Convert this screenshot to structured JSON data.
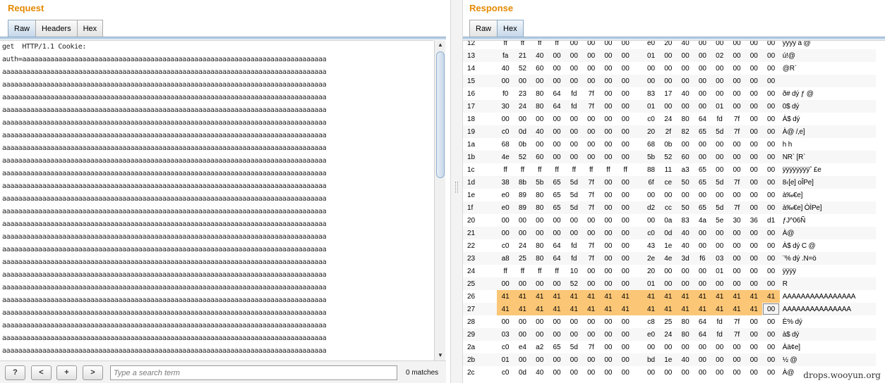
{
  "request": {
    "title": "Request",
    "tabs": [
      {
        "label": "Raw",
        "active": true
      },
      {
        "label": "Headers",
        "active": false
      },
      {
        "label": "Hex",
        "active": false
      }
    ],
    "raw_line_1": "get  HTTP/1.1 Cookie:",
    "raw_line_2": "auth=aaaaaaaaaaaaaaaaaaaaaaaaaaaaaaaaaaaaaaaaaaaaaaaaaaaaaaaaaaaaaaaaaaaaaaaaaaaa",
    "raw_fill_char": "a",
    "search": {
      "help_label": "?",
      "prev_label": "<",
      "add_label": "+",
      "next_label": ">",
      "placeholder": "Type a search term",
      "value": "",
      "matches": "0 matches"
    }
  },
  "response": {
    "title": "Response",
    "tabs": [
      {
        "label": "Raw",
        "active": false
      },
      {
        "label": "Hex",
        "active": true
      }
    ],
    "hex_rows": [
      {
        "off": "12",
        "bytes": [
          "ff",
          "ff",
          "ff",
          "ff",
          "00",
          "00",
          "00",
          "00",
          "e0",
          "20",
          "40",
          "00",
          "00",
          "00",
          "00",
          "00"
        ],
        "ascii": "ÿÿÿÿ        à @"
      },
      {
        "off": "13",
        "bytes": [
          "fa",
          "21",
          "40",
          "00",
          "00",
          "00",
          "00",
          "00",
          "01",
          "00",
          "00",
          "00",
          "02",
          "00",
          "00",
          "00"
        ],
        "ascii": "ú!@"
      },
      {
        "off": "14",
        "bytes": [
          "40",
          "52",
          "60",
          "00",
          "00",
          "00",
          "00",
          "00",
          "00",
          "00",
          "00",
          "00",
          "00",
          "00",
          "00",
          "00"
        ],
        "ascii": "@R`"
      },
      {
        "off": "15",
        "bytes": [
          "00",
          "00",
          "00",
          "00",
          "00",
          "00",
          "00",
          "00",
          "00",
          "00",
          "00",
          "00",
          "00",
          "00",
          "00",
          "00"
        ],
        "ascii": ""
      },
      {
        "off": "16",
        "bytes": [
          "f0",
          "23",
          "80",
          "64",
          "fd",
          "7f",
          "00",
          "00",
          "83",
          "17",
          "40",
          "00",
          "00",
          "00",
          "00",
          "00"
        ],
        "ascii": "ð# dý      ƒ @"
      },
      {
        "off": "17",
        "bytes": [
          "30",
          "24",
          "80",
          "64",
          "fd",
          "7f",
          "00",
          "00",
          "01",
          "00",
          "00",
          "00",
          "01",
          "00",
          "00",
          "00"
        ],
        "ascii": "0$ dý"
      },
      {
        "off": "18",
        "bytes": [
          "00",
          "00",
          "00",
          "00",
          "00",
          "00",
          "00",
          "00",
          "c0",
          "24",
          "80",
          "64",
          "fd",
          "7f",
          "00",
          "00"
        ],
        "ascii": "            À$ dý"
      },
      {
        "off": "19",
        "bytes": [
          "c0",
          "0d",
          "40",
          "00",
          "00",
          "00",
          "00",
          "00",
          "20",
          "2f",
          "82",
          "65",
          "5d",
          "7f",
          "00",
          "00"
        ],
        "ascii": "À@          /‚e]"
      },
      {
        "off": "1a",
        "bytes": [
          "68",
          "0b",
          "00",
          "00",
          "00",
          "00",
          "00",
          "00",
          "68",
          "0b",
          "00",
          "00",
          "00",
          "00",
          "00",
          "00"
        ],
        "ascii": "h           h"
      },
      {
        "off": "1b",
        "bytes": [
          "4e",
          "52",
          "60",
          "00",
          "00",
          "00",
          "00",
          "00",
          "5b",
          "52",
          "60",
          "00",
          "00",
          "00",
          "00",
          "00"
        ],
        "ascii": "NR`         [R`"
      },
      {
        "off": "1c",
        "bytes": [
          "ff",
          "ff",
          "ff",
          "ff",
          "ff",
          "ff",
          "ff",
          "ff",
          "88",
          "11",
          "a3",
          "65",
          "00",
          "00",
          "00",
          "00"
        ],
        "ascii": "ÿÿÿÿÿÿÿÿˆ £e"
      },
      {
        "off": "1d",
        "bytes": [
          "38",
          "8b",
          "5b",
          "65",
          "5d",
          "7f",
          "00",
          "00",
          "6f",
          "ce",
          "50",
          "65",
          "5d",
          "7f",
          "00",
          "00"
        ],
        "ascii": "8‹[e]      oÎPe]"
      },
      {
        "off": "1e",
        "bytes": [
          "e0",
          "89",
          "80",
          "65",
          "5d",
          "7f",
          "00",
          "00",
          "00",
          "00",
          "00",
          "00",
          "00",
          "00",
          "00",
          "00"
        ],
        "ascii": "à‰€e]"
      },
      {
        "off": "1f",
        "bytes": [
          "e0",
          "89",
          "80",
          "65",
          "5d",
          "7f",
          "00",
          "00",
          "d2",
          "cc",
          "50",
          "65",
          "5d",
          "7f",
          "00",
          "00"
        ],
        "ascii": "à‰€e]      ÒÌPe]"
      },
      {
        "off": "20",
        "bytes": [
          "00",
          "00",
          "00",
          "00",
          "00",
          "00",
          "00",
          "00",
          "00",
          "0a",
          "83",
          "4a",
          "5e",
          "30",
          "36",
          "d1"
        ],
        "ascii": "             ƒJ^06Ñ"
      },
      {
        "off": "21",
        "bytes": [
          "00",
          "00",
          "00",
          "00",
          "00",
          "00",
          "00",
          "00",
          "c0",
          "0d",
          "40",
          "00",
          "00",
          "00",
          "00",
          "00"
        ],
        "ascii": "            À@"
      },
      {
        "off": "22",
        "bytes": [
          "c0",
          "24",
          "80",
          "64",
          "fd",
          "7f",
          "00",
          "00",
          "43",
          "1e",
          "40",
          "00",
          "00",
          "00",
          "00",
          "00"
        ],
        "ascii": "À$ dý      C @"
      },
      {
        "off": "23",
        "bytes": [
          "a8",
          "25",
          "80",
          "64",
          "fd",
          "7f",
          "00",
          "00",
          "2e",
          "4e",
          "3d",
          "f6",
          "03",
          "00",
          "00",
          "00"
        ],
        "ascii": "¨% dý      .N=ö"
      },
      {
        "off": "24",
        "bytes": [
          "ff",
          "ff",
          "ff",
          "ff",
          "10",
          "00",
          "00",
          "00",
          "20",
          "00",
          "00",
          "00",
          "01",
          "00",
          "00",
          "00"
        ],
        "ascii": "ÿÿÿÿ"
      },
      {
        "off": "25",
        "bytes": [
          "00",
          "00",
          "00",
          "00",
          "52",
          "00",
          "00",
          "00",
          "01",
          "00",
          "00",
          "00",
          "00",
          "00",
          "00",
          "00"
        ],
        "ascii": "      R"
      },
      {
        "off": "26",
        "bytes": [
          "41",
          "41",
          "41",
          "41",
          "41",
          "41",
          "41",
          "41",
          "41",
          "41",
          "41",
          "41",
          "41",
          "41",
          "41",
          "41"
        ],
        "ascii": "AAAAAAAAAAAAAAAA",
        "highlight": true
      },
      {
        "off": "27",
        "bytes": [
          "41",
          "41",
          "41",
          "41",
          "41",
          "41",
          "41",
          "41",
          "41",
          "41",
          "41",
          "41",
          "41",
          "41",
          "41",
          "00"
        ],
        "ascii": "AAAAAAAAAAAAAAA",
        "highlight": true,
        "cursor": 15
      },
      {
        "off": "28",
        "bytes": [
          "00",
          "00",
          "00",
          "00",
          "00",
          "00",
          "00",
          "00",
          "c8",
          "25",
          "80",
          "64",
          "fd",
          "7f",
          "00",
          "00"
        ],
        "ascii": "            È% dý"
      },
      {
        "off": "29",
        "bytes": [
          "03",
          "00",
          "00",
          "00",
          "00",
          "00",
          "00",
          "00",
          "e0",
          "24",
          "80",
          "64",
          "fd",
          "7f",
          "00",
          "00"
        ],
        "ascii": "            à$ dý"
      },
      {
        "off": "2a",
        "bytes": [
          "c0",
          "e4",
          "a2",
          "65",
          "5d",
          "7f",
          "00",
          "00",
          "00",
          "00",
          "00",
          "00",
          "00",
          "00",
          "00",
          "00"
        ],
        "ascii": "Àä¢e]"
      },
      {
        "off": "2b",
        "bytes": [
          "01",
          "00",
          "00",
          "00",
          "00",
          "00",
          "00",
          "00",
          "bd",
          "1e",
          "40",
          "00",
          "00",
          "00",
          "00",
          "00"
        ],
        "ascii": "            ½ @"
      },
      {
        "off": "2c",
        "bytes": [
          "c0",
          "0d",
          "40",
          "00",
          "00",
          "00",
          "00",
          "00",
          "00",
          "00",
          "00",
          "00",
          "00",
          "00",
          "00",
          "00"
        ],
        "ascii": "À@"
      }
    ]
  },
  "watermark": "drops.wooyun.org"
}
